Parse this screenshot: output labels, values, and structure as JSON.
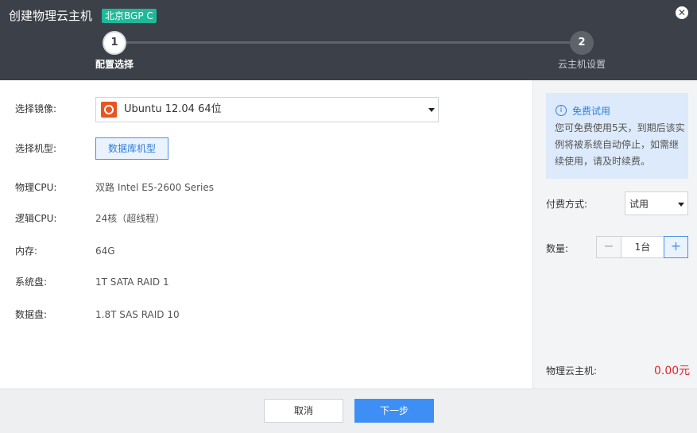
{
  "header": {
    "title": "创建物理云主机",
    "region": "北京BGP C",
    "close_icon": "close-icon"
  },
  "steps": [
    {
      "number": "1",
      "label": "配置选择",
      "active": true
    },
    {
      "number": "2",
      "label": "云主机设置",
      "active": false
    }
  ],
  "form": {
    "image_label": "选择镜像:",
    "image_value": "Ubuntu 12.04 64位",
    "image_icon": "ubuntu-icon",
    "type_label": "选择机型:",
    "type_button": "数据库机型",
    "specs": [
      {
        "label": "物理CPU:",
        "value": "双路 Intel E5-2600 Series"
      },
      {
        "label": "逻辑CPU:",
        "value": "24核（超线程）"
      },
      {
        "label": "内存:",
        "value": "64G"
      },
      {
        "label": "系统盘:",
        "value": "1T SATA RAID 1"
      },
      {
        "label": "数据盘:",
        "value": "1.8T SAS RAID 10"
      }
    ]
  },
  "sidebar": {
    "trial_title": "免费试用",
    "trial_text": "您可免费使用5天，到期后该实例将被系统自动停止，如需继续使用，请及时续费。",
    "pay_label": "付费方式:",
    "pay_value": "试用",
    "qty_label": "数量:",
    "qty_minus": "−",
    "qty_value": "1台",
    "qty_plus": "+",
    "price_label": "物理云主机:",
    "price_value": "0.00元"
  },
  "footer": {
    "cancel_label": "取消",
    "next_label": "下一步"
  },
  "colors": {
    "header_bg": "#3c4049",
    "region_badge": "#1fb99a",
    "accent_blue": "#3d8ff5",
    "price_red": "#e0262a"
  }
}
